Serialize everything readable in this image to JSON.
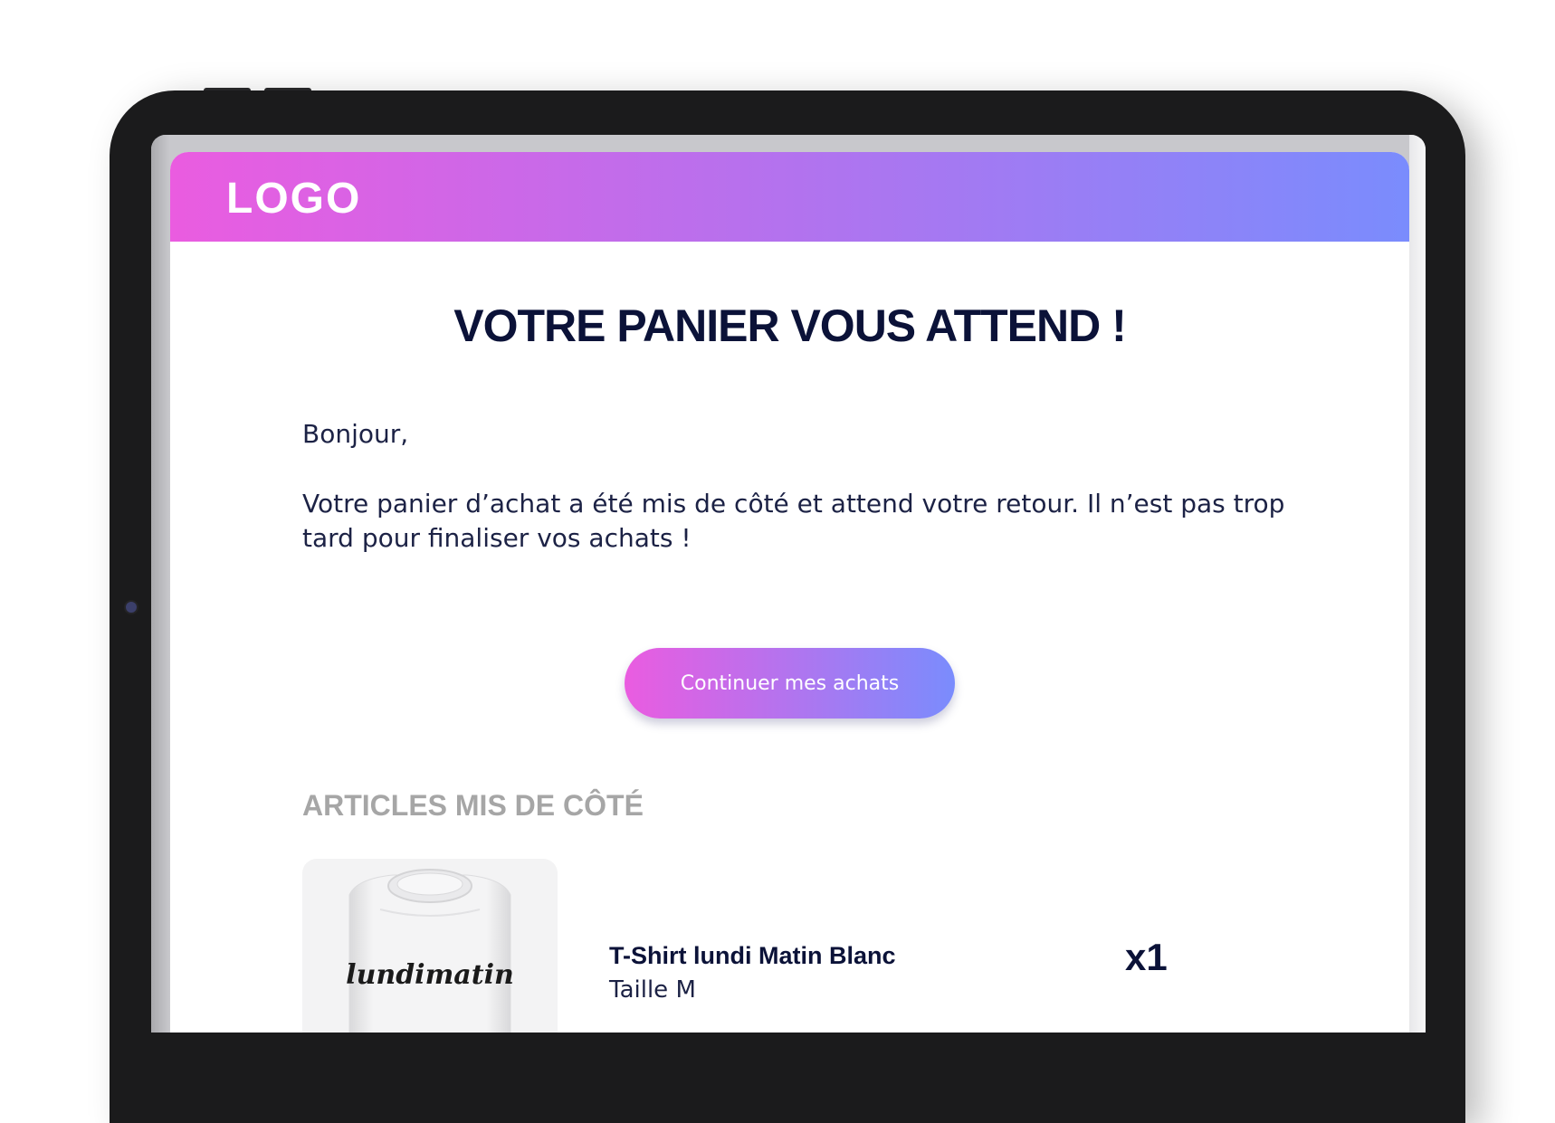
{
  "email": {
    "logo": "LOGO",
    "title": "VOTRE PANIER VOUS ATTEND !",
    "greeting": "Bonjour,",
    "message": "Votre panier d’achat a été mis de côté et attend votre retour. Il n’est pas trop tard pour finaliser vos achats !",
    "cta_label": "Continuer mes achats",
    "section_title": "ARTICLES MIS DE CÔTÉ",
    "product": {
      "image_icon": "tshirt-image",
      "brand_print": "lundimatin",
      "name": "T-Shirt lundi Matin Blanc",
      "size": "Taille M",
      "quantity": "x1"
    }
  },
  "colors": {
    "gradient_start": "#ea5ce0",
    "gradient_end": "#7a8cfd",
    "title_navy": "#0b1238",
    "section_gray": "#a6a6a6",
    "device_frame": "#1b1b1c"
  }
}
